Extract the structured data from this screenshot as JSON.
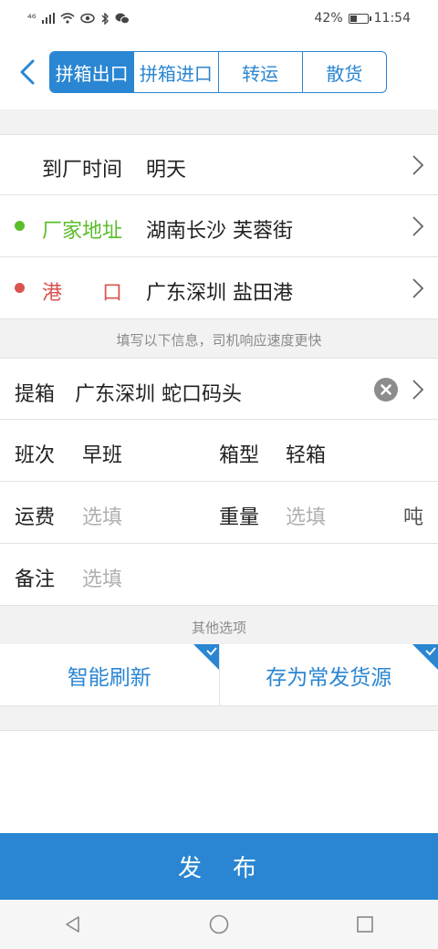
{
  "status": {
    "signal": "⁴⁶",
    "battery": "42%",
    "time": "11:54",
    "battery_level": 0.42
  },
  "tabs": [
    {
      "label": "拼箱出口",
      "active": true
    },
    {
      "label": "拼箱进口",
      "active": false
    },
    {
      "label": "转运",
      "active": false
    },
    {
      "label": "散货",
      "active": false
    }
  ],
  "arrival": {
    "label": "到厂时间",
    "value": "明天"
  },
  "factory": {
    "label": "厂家地址",
    "value": "湖南长沙 芙蓉街",
    "color": "#5bbd2b"
  },
  "port": {
    "label": "港　　口",
    "value": "广东深圳 盐田港",
    "color": "#d9534f"
  },
  "hint": "填写以下信息，司机响应速度更快",
  "pickup": {
    "label": "提箱",
    "value": "广东深圳 蛇口码头"
  },
  "shift": {
    "label": "班次",
    "value": "早班"
  },
  "box_type": {
    "label": "箱型",
    "value": "轻箱"
  },
  "freight": {
    "label": "运费",
    "placeholder": "选填"
  },
  "weight": {
    "label": "重量",
    "placeholder": "选填",
    "unit": "吨"
  },
  "remark": {
    "label": "备注",
    "placeholder": "选填"
  },
  "other_options": {
    "title": "其他选项",
    "smart_refresh": "智能刷新",
    "save_source": "存为常发货源"
  },
  "publish": "发　布",
  "accent": "#2a86d2"
}
